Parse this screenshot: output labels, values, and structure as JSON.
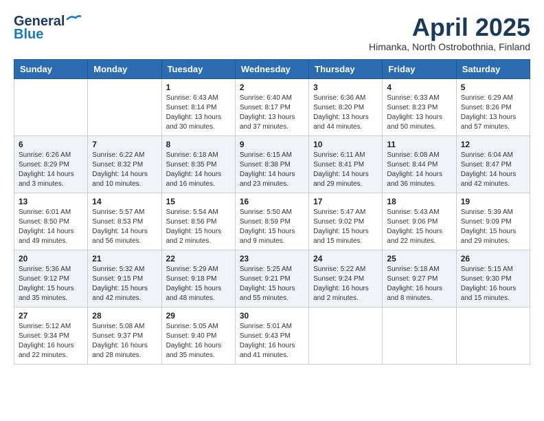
{
  "header": {
    "logo_general": "General",
    "logo_blue": "Blue",
    "month_year": "April 2025",
    "location": "Himanka, North Ostrobothnia, Finland"
  },
  "calendar": {
    "weekdays": [
      "Sunday",
      "Monday",
      "Tuesday",
      "Wednesday",
      "Thursday",
      "Friday",
      "Saturday"
    ],
    "weeks": [
      [
        {
          "day": "",
          "info": ""
        },
        {
          "day": "",
          "info": ""
        },
        {
          "day": "1",
          "info": "Sunrise: 6:43 AM\nSunset: 8:14 PM\nDaylight: 13 hours\nand 30 minutes."
        },
        {
          "day": "2",
          "info": "Sunrise: 6:40 AM\nSunset: 8:17 PM\nDaylight: 13 hours\nand 37 minutes."
        },
        {
          "day": "3",
          "info": "Sunrise: 6:36 AM\nSunset: 8:20 PM\nDaylight: 13 hours\nand 44 minutes."
        },
        {
          "day": "4",
          "info": "Sunrise: 6:33 AM\nSunset: 8:23 PM\nDaylight: 13 hours\nand 50 minutes."
        },
        {
          "day": "5",
          "info": "Sunrise: 6:29 AM\nSunset: 8:26 PM\nDaylight: 13 hours\nand 57 minutes."
        }
      ],
      [
        {
          "day": "6",
          "info": "Sunrise: 6:26 AM\nSunset: 8:29 PM\nDaylight: 14 hours\nand 3 minutes."
        },
        {
          "day": "7",
          "info": "Sunrise: 6:22 AM\nSunset: 8:32 PM\nDaylight: 14 hours\nand 10 minutes."
        },
        {
          "day": "8",
          "info": "Sunrise: 6:18 AM\nSunset: 8:35 PM\nDaylight: 14 hours\nand 16 minutes."
        },
        {
          "day": "9",
          "info": "Sunrise: 6:15 AM\nSunset: 8:38 PM\nDaylight: 14 hours\nand 23 minutes."
        },
        {
          "day": "10",
          "info": "Sunrise: 6:11 AM\nSunset: 8:41 PM\nDaylight: 14 hours\nand 29 minutes."
        },
        {
          "day": "11",
          "info": "Sunrise: 6:08 AM\nSunset: 8:44 PM\nDaylight: 14 hours\nand 36 minutes."
        },
        {
          "day": "12",
          "info": "Sunrise: 6:04 AM\nSunset: 8:47 PM\nDaylight: 14 hours\nand 42 minutes."
        }
      ],
      [
        {
          "day": "13",
          "info": "Sunrise: 6:01 AM\nSunset: 8:50 PM\nDaylight: 14 hours\nand 49 minutes."
        },
        {
          "day": "14",
          "info": "Sunrise: 5:57 AM\nSunset: 8:53 PM\nDaylight: 14 hours\nand 56 minutes."
        },
        {
          "day": "15",
          "info": "Sunrise: 5:54 AM\nSunset: 8:56 PM\nDaylight: 15 hours\nand 2 minutes."
        },
        {
          "day": "16",
          "info": "Sunrise: 5:50 AM\nSunset: 8:59 PM\nDaylight: 15 hours\nand 9 minutes."
        },
        {
          "day": "17",
          "info": "Sunrise: 5:47 AM\nSunset: 9:02 PM\nDaylight: 15 hours\nand 15 minutes."
        },
        {
          "day": "18",
          "info": "Sunrise: 5:43 AM\nSunset: 9:06 PM\nDaylight: 15 hours\nand 22 minutes."
        },
        {
          "day": "19",
          "info": "Sunrise: 5:39 AM\nSunset: 9:09 PM\nDaylight: 15 hours\nand 29 minutes."
        }
      ],
      [
        {
          "day": "20",
          "info": "Sunrise: 5:36 AM\nSunset: 9:12 PM\nDaylight: 15 hours\nand 35 minutes."
        },
        {
          "day": "21",
          "info": "Sunrise: 5:32 AM\nSunset: 9:15 PM\nDaylight: 15 hours\nand 42 minutes."
        },
        {
          "day": "22",
          "info": "Sunrise: 5:29 AM\nSunset: 9:18 PM\nDaylight: 15 hours\nand 48 minutes."
        },
        {
          "day": "23",
          "info": "Sunrise: 5:25 AM\nSunset: 9:21 PM\nDaylight: 15 hours\nand 55 minutes."
        },
        {
          "day": "24",
          "info": "Sunrise: 5:22 AM\nSunset: 9:24 PM\nDaylight: 16 hours\nand 2 minutes."
        },
        {
          "day": "25",
          "info": "Sunrise: 5:18 AM\nSunset: 9:27 PM\nDaylight: 16 hours\nand 8 minutes."
        },
        {
          "day": "26",
          "info": "Sunrise: 5:15 AM\nSunset: 9:30 PM\nDaylight: 16 hours\nand 15 minutes."
        }
      ],
      [
        {
          "day": "27",
          "info": "Sunrise: 5:12 AM\nSunset: 9:34 PM\nDaylight: 16 hours\nand 22 minutes."
        },
        {
          "day": "28",
          "info": "Sunrise: 5:08 AM\nSunset: 9:37 PM\nDaylight: 16 hours\nand 28 minutes."
        },
        {
          "day": "29",
          "info": "Sunrise: 5:05 AM\nSunset: 9:40 PM\nDaylight: 16 hours\nand 35 minutes."
        },
        {
          "day": "30",
          "info": "Sunrise: 5:01 AM\nSunset: 9:43 PM\nDaylight: 16 hours\nand 41 minutes."
        },
        {
          "day": "",
          "info": ""
        },
        {
          "day": "",
          "info": ""
        },
        {
          "day": "",
          "info": ""
        }
      ]
    ]
  }
}
